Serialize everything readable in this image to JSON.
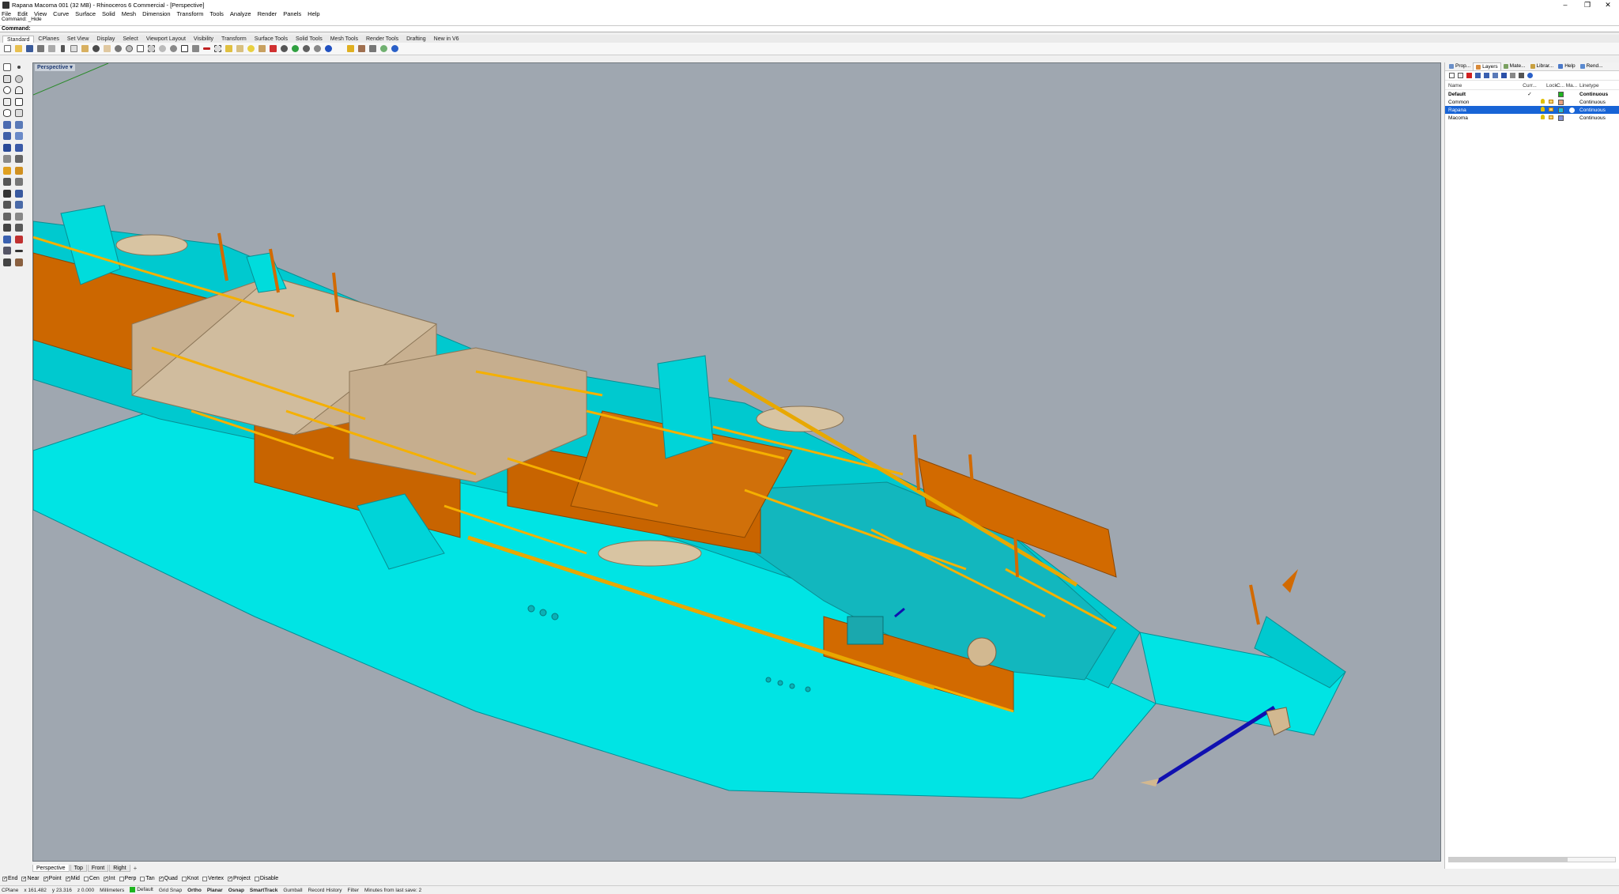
{
  "titlebar": {
    "title": "Rapana Macoma 001 (32 MB) - Rhinoceros 6 Commercial - [Perspective]",
    "min_icon": "minimize-icon",
    "max_icon": "maximize-icon",
    "close_icon": "close-icon"
  },
  "menu": [
    "File",
    "Edit",
    "View",
    "Curve",
    "Surface",
    "Solid",
    "Mesh",
    "Dimension",
    "Transform",
    "Tools",
    "Analyze",
    "Render",
    "Panels",
    "Help"
  ],
  "command": {
    "history": [
      "Command: _Hide"
    ],
    "prompt": "Command:",
    "value": ""
  },
  "toolbar_tabs": [
    "Standard",
    "CPlanes",
    "Set View",
    "Display",
    "Select",
    "Viewport Layout",
    "Visibility",
    "Transform",
    "Surface Tools",
    "Solid Tools",
    "Mesh Tools",
    "Render Tools",
    "Drafting",
    "New in V6"
  ],
  "toolbar_tabs_active": "Standard",
  "viewport": {
    "label": "Perspective",
    "background": "#9fa7b0"
  },
  "view_tabs": [
    "Perspective",
    "Top",
    "Front",
    "Right"
  ],
  "view_tabs_active": "Perspective",
  "osnaps": [
    {
      "label": "End",
      "checked": true
    },
    {
      "label": "Near",
      "checked": true
    },
    {
      "label": "Point",
      "checked": true
    },
    {
      "label": "Mid",
      "checked": true
    },
    {
      "label": "Cen",
      "checked": false
    },
    {
      "label": "Int",
      "checked": true
    },
    {
      "label": "Perp",
      "checked": false
    },
    {
      "label": "Tan",
      "checked": false
    },
    {
      "label": "Quad",
      "checked": true
    },
    {
      "label": "Knot",
      "checked": false
    },
    {
      "label": "Vertex",
      "checked": false
    },
    {
      "label": "Project",
      "checked": true
    },
    {
      "label": "Disable",
      "checked": false
    }
  ],
  "status": {
    "cplane": "CPlane",
    "x": "x 161.482",
    "y": "y 23.316",
    "z": "z 0.000",
    "units": "Millimeters",
    "layer": "Default",
    "layer_color": "#1fb51f",
    "items": [
      "Grid Snap",
      "Ortho",
      "Planar",
      "Osnap",
      "SmartTrack",
      "Gumball",
      "Record History",
      "Filter"
    ],
    "bold_items": [
      "Ortho",
      "Planar",
      "Osnap",
      "SmartTrack"
    ],
    "save_msg": "Minutes from last save: 2"
  },
  "panel_tabs": [
    {
      "label": "Prop...",
      "icon": "properties-icon",
      "color": "#6a8fc8"
    },
    {
      "label": "Layers",
      "icon": "layers-icon",
      "color": "#d88a3a"
    },
    {
      "label": "Mate...",
      "icon": "materials-icon",
      "color": "#7aa060"
    },
    {
      "label": "Librar...",
      "icon": "libraries-icon",
      "color": "#c8a040"
    },
    {
      "label": "Help",
      "icon": "help-icon",
      "color": "#4a78c8"
    },
    {
      "label": "Rend...",
      "icon": "render-icon",
      "color": "#5a8ad0"
    }
  ],
  "panel_tabs_active": "Layers",
  "layers": {
    "headers": {
      "name": "Name",
      "current": "Curr...",
      "lock": "Lock",
      "color": "C...",
      "material": "Ma...",
      "linetype": "Linetype"
    },
    "rows": [
      {
        "name": "Default",
        "current": "✓",
        "color": "#1fb51f",
        "linetype": "Continuous",
        "selected": false,
        "bold": true
      },
      {
        "name": "Common",
        "current": "",
        "color": "#e8a080",
        "linetype": "Continuous",
        "selected": false,
        "bold": false
      },
      {
        "name": "Rapana",
        "current": "",
        "color": "#20c0d8",
        "linetype": "Continuous",
        "selected": true,
        "bold": false
      },
      {
        "name": "Macoma",
        "current": "",
        "color": "#8090e0",
        "linetype": "Continuous",
        "selected": false,
        "bold": false
      }
    ]
  },
  "colors": {
    "hull_cyan": "#00e4e4",
    "deck_cyan_dark": "#00b8c0",
    "bulkhead_orange": "#d26a00",
    "rail_yellow": "#f5b000",
    "deckhouse_tan": "#c8b090",
    "highlight_blue": "#1010b0"
  }
}
